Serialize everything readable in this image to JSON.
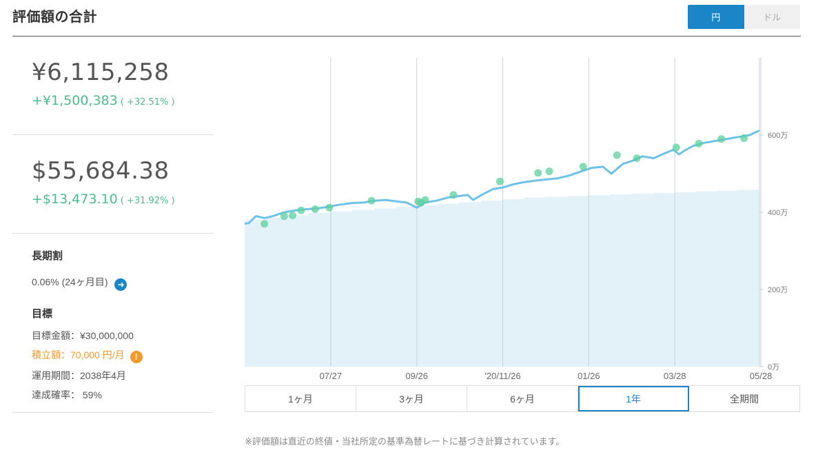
{
  "header": {
    "title": "評価額の合計",
    "currency_toggle": {
      "yen": "円",
      "dollar": "ドル",
      "selected": "円"
    }
  },
  "totals": {
    "jpy": {
      "value": "¥6,115,258",
      "gain": "+¥1,500,383",
      "gain_pct": "( +32.51% )"
    },
    "usd": {
      "value": "$55,684.38",
      "gain": "+$13,473.10",
      "gain_pct": "( +31.92% )"
    }
  },
  "long_term": {
    "heading": "長期割",
    "value": "0.06% (24ヶ月目)"
  },
  "goal": {
    "heading": "目標",
    "target": "目標金額：¥30,000,000",
    "monthly": "積立額：70,000 円/月",
    "period": "運用期間：2038年4月",
    "probability": "達成確率： 59%"
  },
  "ranges": {
    "items": [
      "1ヶ月",
      "3ヶ月",
      "6ヶ月",
      "1年",
      "全期間"
    ],
    "selected": "1年"
  },
  "footnote": "※評価額は直近の終値・当社所定の基準為替レートに基づき計算されています。",
  "colors": {
    "accent": "#1a86c8",
    "gain": "#4cbb8d",
    "line": "#6ec1e8",
    "area": "#e3f1f9",
    "marker": "#5ccf9e",
    "warning": "#f39a2a"
  },
  "chart_data": {
    "type": "line",
    "x_tick_labels": [
      "07/27",
      "09/26",
      "'20/11/26",
      "01/26",
      "03/28",
      "05/28"
    ],
    "y_tick_labels": [
      "0万",
      "200万",
      "400万",
      "600万"
    ],
    "ylim": [
      0,
      800
    ],
    "y_unit": "万円",
    "x_domain_days": [
      0,
      365
    ],
    "x_tick_days": [
      61,
      122,
      183,
      244,
      305,
      366
    ],
    "series": [
      {
        "kind": "line",
        "points": [
          [
            0,
            370
          ],
          [
            3,
            372
          ],
          [
            8,
            390
          ],
          [
            14,
            385
          ],
          [
            20,
            390
          ],
          [
            28,
            400
          ],
          [
            36,
            405
          ],
          [
            44,
            408
          ],
          [
            52,
            410
          ],
          [
            60,
            415
          ],
          [
            68,
            420
          ],
          [
            76,
            424
          ],
          [
            84,
            425
          ],
          [
            92,
            430
          ],
          [
            100,
            432
          ],
          [
            108,
            428
          ],
          [
            115,
            425
          ],
          [
            122,
            412
          ],
          [
            128,
            425
          ],
          [
            136,
            430
          ],
          [
            144,
            438
          ],
          [
            152,
            442
          ],
          [
            158,
            445
          ],
          [
            162,
            432
          ],
          [
            168,
            445
          ],
          [
            176,
            460
          ],
          [
            184,
            465
          ],
          [
            190,
            472
          ],
          [
            198,
            478
          ],
          [
            206,
            482
          ],
          [
            214,
            485
          ],
          [
            222,
            488
          ],
          [
            230,
            495
          ],
          [
            238,
            505
          ],
          [
            246,
            515
          ],
          [
            254,
            518
          ],
          [
            260,
            500
          ],
          [
            268,
            525
          ],
          [
            276,
            535
          ],
          [
            282,
            545
          ],
          [
            290,
            540
          ],
          [
            296,
            550
          ],
          [
            304,
            562
          ],
          [
            308,
            550
          ],
          [
            312,
            560
          ],
          [
            318,
            572
          ],
          [
            326,
            580
          ],
          [
            334,
            585
          ],
          [
            342,
            590
          ],
          [
            350,
            595
          ],
          [
            358,
            600
          ],
          [
            365,
            612
          ]
        ]
      },
      {
        "kind": "area",
        "steps": [
          [
            0,
            380
          ],
          [
            15,
            386
          ],
          [
            30,
            392
          ],
          [
            45,
            398
          ],
          [
            61,
            402
          ],
          [
            76,
            406
          ],
          [
            92,
            410
          ],
          [
            107,
            414
          ],
          [
            122,
            418
          ],
          [
            137,
            422
          ],
          [
            152,
            426
          ],
          [
            168,
            430
          ],
          [
            183,
            434
          ],
          [
            198,
            438
          ],
          [
            213,
            440
          ],
          [
            229,
            442
          ],
          [
            244,
            444
          ],
          [
            259,
            446
          ],
          [
            274,
            448
          ],
          [
            290,
            450
          ],
          [
            305,
            452
          ],
          [
            320,
            454
          ],
          [
            335,
            456
          ],
          [
            350,
            458
          ],
          [
            365,
            460
          ]
        ]
      },
      {
        "kind": "markers",
        "points": [
          [
            14,
            370
          ],
          [
            28,
            390
          ],
          [
            34,
            392
          ],
          [
            40,
            405
          ],
          [
            50,
            408
          ],
          [
            60,
            412
          ],
          [
            90,
            430
          ],
          [
            123,
            428
          ],
          [
            125,
            425
          ],
          [
            128,
            432
          ],
          [
            148,
            445
          ],
          [
            181,
            480
          ],
          [
            208,
            502
          ],
          [
            216,
            506
          ],
          [
            240,
            518
          ],
          [
            264,
            548
          ],
          [
            278,
            540
          ],
          [
            306,
            568
          ],
          [
            322,
            578
          ],
          [
            338,
            590
          ],
          [
            354,
            592
          ]
        ]
      }
    ]
  }
}
